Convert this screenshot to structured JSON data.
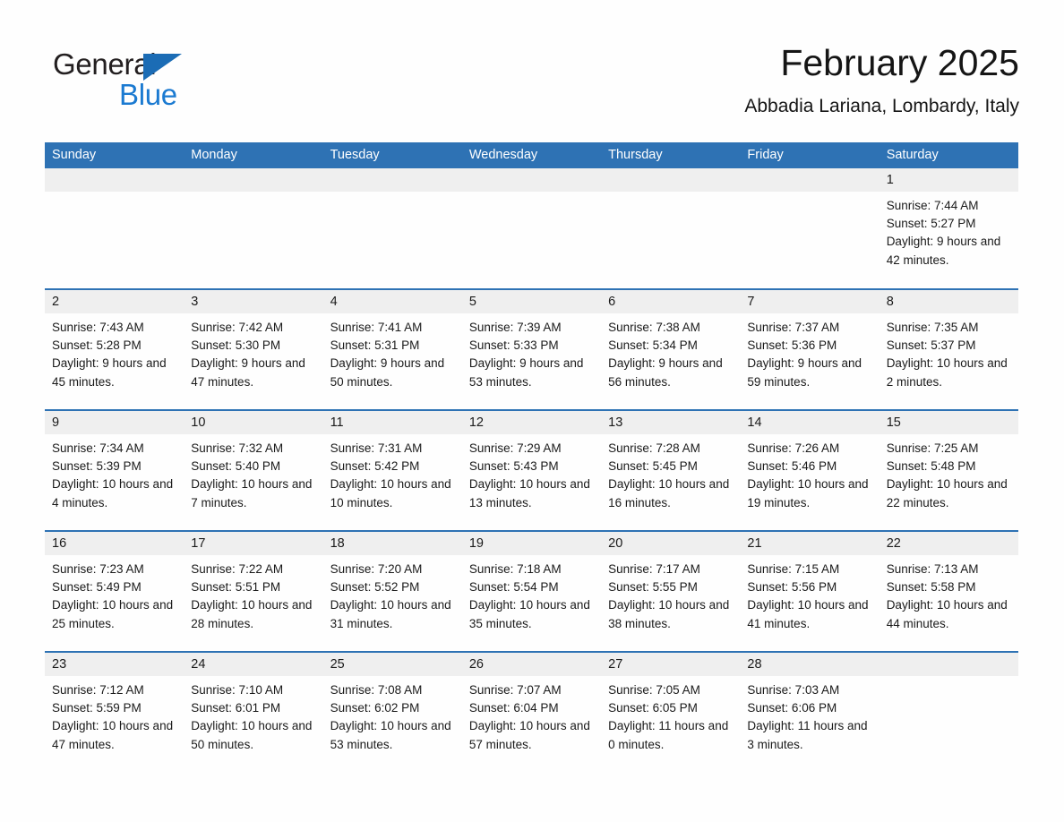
{
  "logo": {
    "word1": "General",
    "word2": "Blue",
    "triangle_color": "#1b6cb5",
    "blue_color": "#1b7ad1"
  },
  "header": {
    "title": "February 2025",
    "subtitle": "Abbadia Lariana, Lombardy, Italy",
    "accent_color": "#2e72b4",
    "daynum_bg": "#efefef"
  },
  "weekdays": [
    "Sunday",
    "Monday",
    "Tuesday",
    "Wednesday",
    "Thursday",
    "Friday",
    "Saturday"
  ],
  "labels": {
    "sunrise": "Sunrise:",
    "sunset": "Sunset:",
    "daylight": "Daylight:"
  },
  "weeks": [
    [
      {
        "day": "",
        "sunrise": "",
        "sunset": "",
        "daylight": ""
      },
      {
        "day": "",
        "sunrise": "",
        "sunset": "",
        "daylight": ""
      },
      {
        "day": "",
        "sunrise": "",
        "sunset": "",
        "daylight": ""
      },
      {
        "day": "",
        "sunrise": "",
        "sunset": "",
        "daylight": ""
      },
      {
        "day": "",
        "sunrise": "",
        "sunset": "",
        "daylight": ""
      },
      {
        "day": "",
        "sunrise": "",
        "sunset": "",
        "daylight": ""
      },
      {
        "day": "1",
        "sunrise": "Sunrise: 7:44 AM",
        "sunset": "Sunset: 5:27 PM",
        "daylight": "Daylight: 9 hours and 42 minutes."
      }
    ],
    [
      {
        "day": "2",
        "sunrise": "Sunrise: 7:43 AM",
        "sunset": "Sunset: 5:28 PM",
        "daylight": "Daylight: 9 hours and 45 minutes."
      },
      {
        "day": "3",
        "sunrise": "Sunrise: 7:42 AM",
        "sunset": "Sunset: 5:30 PM",
        "daylight": "Daylight: 9 hours and 47 minutes."
      },
      {
        "day": "4",
        "sunrise": "Sunrise: 7:41 AM",
        "sunset": "Sunset: 5:31 PM",
        "daylight": "Daylight: 9 hours and 50 minutes."
      },
      {
        "day": "5",
        "sunrise": "Sunrise: 7:39 AM",
        "sunset": "Sunset: 5:33 PM",
        "daylight": "Daylight: 9 hours and 53 minutes."
      },
      {
        "day": "6",
        "sunrise": "Sunrise: 7:38 AM",
        "sunset": "Sunset: 5:34 PM",
        "daylight": "Daylight: 9 hours and 56 minutes."
      },
      {
        "day": "7",
        "sunrise": "Sunrise: 7:37 AM",
        "sunset": "Sunset: 5:36 PM",
        "daylight": "Daylight: 9 hours and 59 minutes."
      },
      {
        "day": "8",
        "sunrise": "Sunrise: 7:35 AM",
        "sunset": "Sunset: 5:37 PM",
        "daylight": "Daylight: 10 hours and 2 minutes."
      }
    ],
    [
      {
        "day": "9",
        "sunrise": "Sunrise: 7:34 AM",
        "sunset": "Sunset: 5:39 PM",
        "daylight": "Daylight: 10 hours and 4 minutes."
      },
      {
        "day": "10",
        "sunrise": "Sunrise: 7:32 AM",
        "sunset": "Sunset: 5:40 PM",
        "daylight": "Daylight: 10 hours and 7 minutes."
      },
      {
        "day": "11",
        "sunrise": "Sunrise: 7:31 AM",
        "sunset": "Sunset: 5:42 PM",
        "daylight": "Daylight: 10 hours and 10 minutes."
      },
      {
        "day": "12",
        "sunrise": "Sunrise: 7:29 AM",
        "sunset": "Sunset: 5:43 PM",
        "daylight": "Daylight: 10 hours and 13 minutes."
      },
      {
        "day": "13",
        "sunrise": "Sunrise: 7:28 AM",
        "sunset": "Sunset: 5:45 PM",
        "daylight": "Daylight: 10 hours and 16 minutes."
      },
      {
        "day": "14",
        "sunrise": "Sunrise: 7:26 AM",
        "sunset": "Sunset: 5:46 PM",
        "daylight": "Daylight: 10 hours and 19 minutes."
      },
      {
        "day": "15",
        "sunrise": "Sunrise: 7:25 AM",
        "sunset": "Sunset: 5:48 PM",
        "daylight": "Daylight: 10 hours and 22 minutes."
      }
    ],
    [
      {
        "day": "16",
        "sunrise": "Sunrise: 7:23 AM",
        "sunset": "Sunset: 5:49 PM",
        "daylight": "Daylight: 10 hours and 25 minutes."
      },
      {
        "day": "17",
        "sunrise": "Sunrise: 7:22 AM",
        "sunset": "Sunset: 5:51 PM",
        "daylight": "Daylight: 10 hours and 28 minutes."
      },
      {
        "day": "18",
        "sunrise": "Sunrise: 7:20 AM",
        "sunset": "Sunset: 5:52 PM",
        "daylight": "Daylight: 10 hours and 31 minutes."
      },
      {
        "day": "19",
        "sunrise": "Sunrise: 7:18 AM",
        "sunset": "Sunset: 5:54 PM",
        "daylight": "Daylight: 10 hours and 35 minutes."
      },
      {
        "day": "20",
        "sunrise": "Sunrise: 7:17 AM",
        "sunset": "Sunset: 5:55 PM",
        "daylight": "Daylight: 10 hours and 38 minutes."
      },
      {
        "day": "21",
        "sunrise": "Sunrise: 7:15 AM",
        "sunset": "Sunset: 5:56 PM",
        "daylight": "Daylight: 10 hours and 41 minutes."
      },
      {
        "day": "22",
        "sunrise": "Sunrise: 7:13 AM",
        "sunset": "Sunset: 5:58 PM",
        "daylight": "Daylight: 10 hours and 44 minutes."
      }
    ],
    [
      {
        "day": "23",
        "sunrise": "Sunrise: 7:12 AM",
        "sunset": "Sunset: 5:59 PM",
        "daylight": "Daylight: 10 hours and 47 minutes."
      },
      {
        "day": "24",
        "sunrise": "Sunrise: 7:10 AM",
        "sunset": "Sunset: 6:01 PM",
        "daylight": "Daylight: 10 hours and 50 minutes."
      },
      {
        "day": "25",
        "sunrise": "Sunrise: 7:08 AM",
        "sunset": "Sunset: 6:02 PM",
        "daylight": "Daylight: 10 hours and 53 minutes."
      },
      {
        "day": "26",
        "sunrise": "Sunrise: 7:07 AM",
        "sunset": "Sunset: 6:04 PM",
        "daylight": "Daylight: 10 hours and 57 minutes."
      },
      {
        "day": "27",
        "sunrise": "Sunrise: 7:05 AM",
        "sunset": "Sunset: 6:05 PM",
        "daylight": "Daylight: 11 hours and 0 minutes."
      },
      {
        "day": "28",
        "sunrise": "Sunrise: 7:03 AM",
        "sunset": "Sunset: 6:06 PM",
        "daylight": "Daylight: 11 hours and 3 minutes."
      },
      {
        "day": "",
        "sunrise": "",
        "sunset": "",
        "daylight": ""
      }
    ]
  ]
}
